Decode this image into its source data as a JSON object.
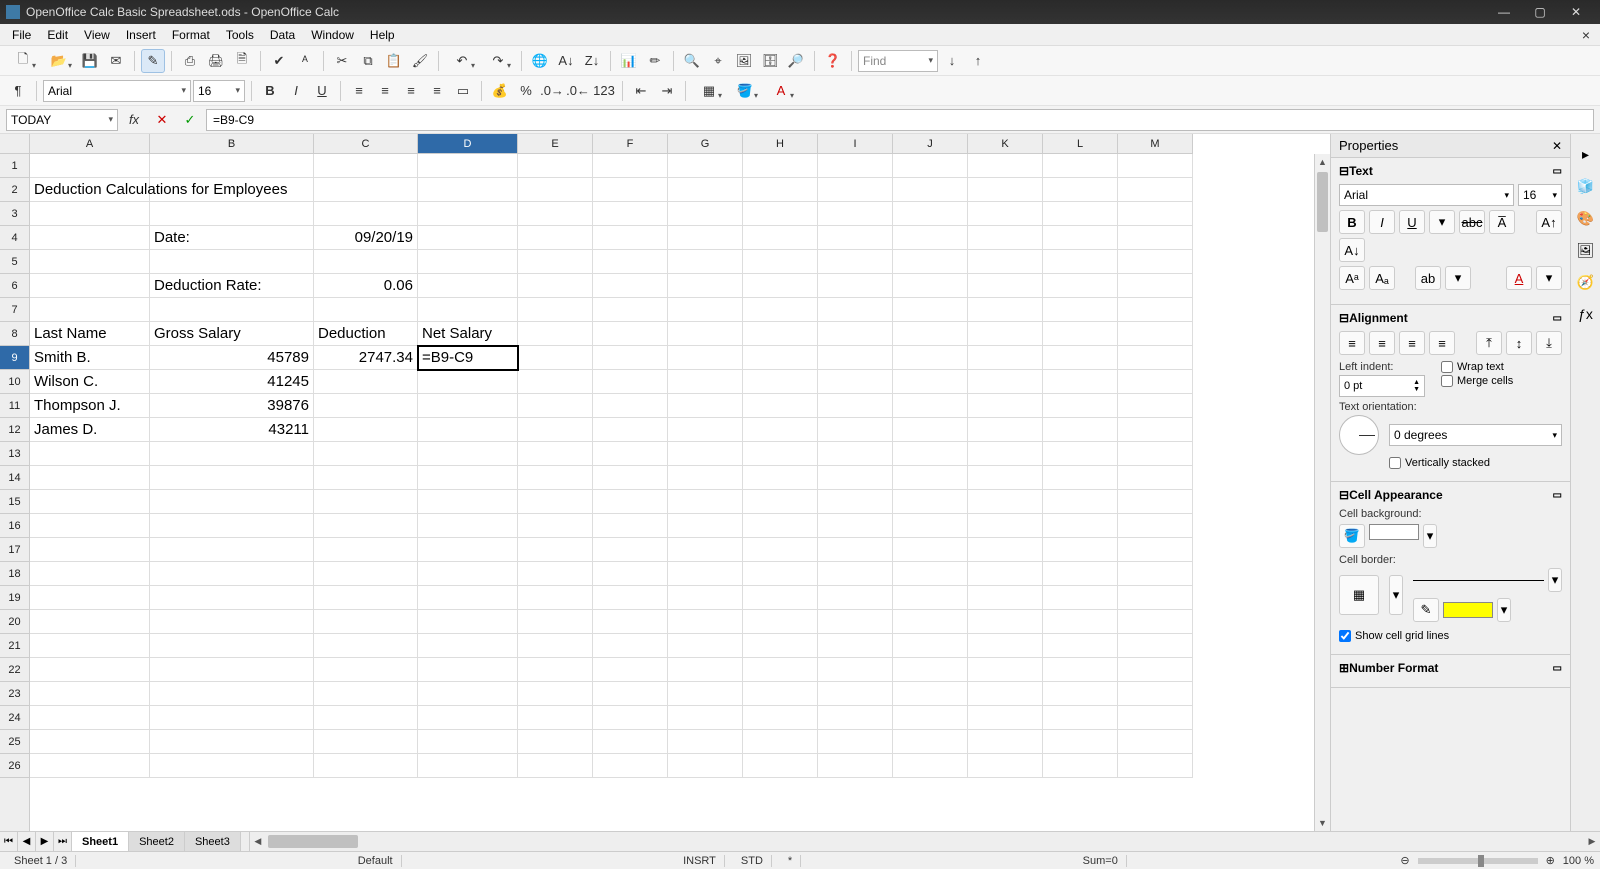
{
  "title": "OpenOffice Calc Basic Spreadsheet.ods - OpenOffice Calc",
  "menu": [
    "File",
    "Edit",
    "View",
    "Insert",
    "Format",
    "Tools",
    "Data",
    "Window",
    "Help"
  ],
  "find_placeholder": "Find",
  "font_name": "Arial",
  "font_size": "16",
  "name_box": "TODAY",
  "formula": "=B9-C9",
  "columns": [
    "A",
    "B",
    "C",
    "D",
    "E",
    "F",
    "G",
    "H",
    "I",
    "J",
    "K",
    "L",
    "M"
  ],
  "selected_col": "D",
  "selected_row": 9,
  "rows": [
    {
      "n": 1,
      "A": "",
      "B": "",
      "C": "",
      "D": ""
    },
    {
      "n": 2,
      "A": "Deduction Calculations for Employees",
      "B": "",
      "C": "",
      "D": ""
    },
    {
      "n": 3,
      "A": "",
      "B": "",
      "C": "",
      "D": ""
    },
    {
      "n": 4,
      "A": "",
      "B": "Date:",
      "C": "09/20/19",
      "D": ""
    },
    {
      "n": 5,
      "A": "",
      "B": "",
      "C": "",
      "D": ""
    },
    {
      "n": 6,
      "A": "",
      "B": "Deduction Rate:",
      "C": "0.06",
      "D": ""
    },
    {
      "n": 7,
      "A": "",
      "B": "",
      "C": "",
      "D": ""
    },
    {
      "n": 8,
      "A": "Last Name",
      "B": "Gross Salary",
      "C": "Deduction",
      "D": "Net Salary"
    },
    {
      "n": 9,
      "A": "Smith B.",
      "B": "45789",
      "C": "2747.34",
      "D": "=B9-C9"
    },
    {
      "n": 10,
      "A": "Wilson C.",
      "B": "41245",
      "C": "",
      "D": ""
    },
    {
      "n": 11,
      "A": "Thompson J.",
      "B": "39876",
      "C": "",
      "D": ""
    },
    {
      "n": 12,
      "A": "James D.",
      "B": "43211",
      "C": "",
      "D": ""
    },
    {
      "n": 13
    },
    {
      "n": 14
    },
    {
      "n": 15
    },
    {
      "n": 16
    },
    {
      "n": 17
    },
    {
      "n": 18
    },
    {
      "n": 19
    },
    {
      "n": 20
    },
    {
      "n": 21
    },
    {
      "n": 22
    },
    {
      "n": 23
    },
    {
      "n": 24
    },
    {
      "n": 25
    },
    {
      "n": 26
    }
  ],
  "numeric_cells": {
    "4": [
      "C"
    ],
    "6": [
      "C"
    ],
    "9": [
      "B",
      "C"
    ],
    "10": [
      "B"
    ],
    "11": [
      "B"
    ],
    "12": [
      "B"
    ]
  },
  "sheets": [
    "Sheet1",
    "Sheet2",
    "Sheet3"
  ],
  "active_sheet": "Sheet1",
  "status": {
    "sheet": "Sheet 1 / 3",
    "style": "Default",
    "insert": "INSRT",
    "std": "STD",
    "extra": "*",
    "sum": "Sum=0",
    "zoom": "100 %"
  },
  "sidebar": {
    "title": "Properties",
    "text": {
      "label": "Text",
      "font": "Arial",
      "size": "16"
    },
    "alignment": {
      "label": "Alignment",
      "left_indent_label": "Left indent:",
      "left_indent_value": "0 pt",
      "wrap_label": "Wrap text",
      "merge_label": "Merge cells",
      "orient_label": "Text orientation:",
      "orient_value": "0 degrees",
      "vstack_label": "Vertically stacked"
    },
    "appearance": {
      "label": "Cell Appearance",
      "bg_label": "Cell background:",
      "border_label": "Cell border:",
      "gridlines_label": "Show cell grid lines",
      "gridlines_checked": true
    },
    "numfmt": {
      "label": "Number Format"
    }
  }
}
